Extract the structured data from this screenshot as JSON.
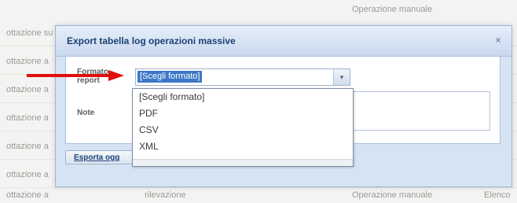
{
  "dialog": {
    "title": "Export tabella log operazioni massive",
    "close_glyph": "×",
    "format_label": "Formato report",
    "format_selected": "[Scegli formato]",
    "select_arrow_glyph": "▾",
    "note_label": "Note",
    "note_value": "",
    "export_button_label": "Esporta ogg",
    "format_options": [
      "[Scegli formato]",
      "PDF",
      "CSV",
      "XML"
    ]
  },
  "background": {
    "row_label": "ottazione a",
    "row_labels": [
      "ottazione su",
      "ottazione a",
      "ottazione a",
      "ottazione a",
      "ottazione a"
    ],
    "col2": "rilevazione",
    "col3": "Operazione manuale",
    "col4": "Elenco"
  },
  "annotation": {
    "arrow_color": "#e01010"
  }
}
